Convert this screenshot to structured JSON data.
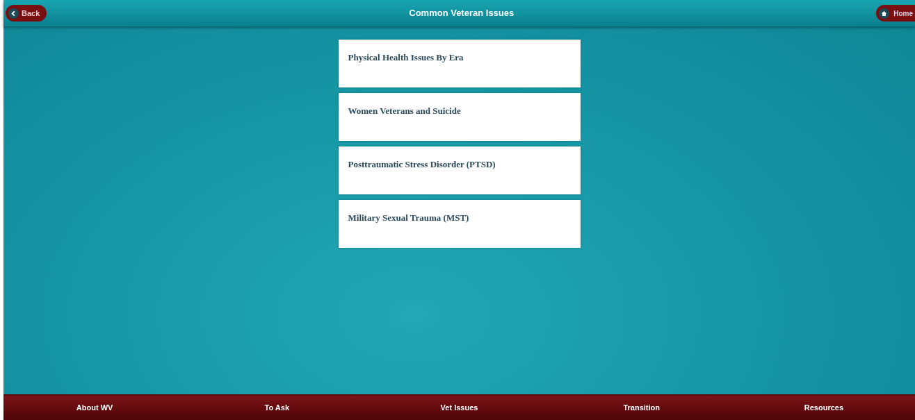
{
  "header": {
    "back_button": "Back",
    "title": "Common Veteran Issues",
    "home_button": "Home"
  },
  "topics": [
    {
      "title": "Physical Health Issues By Era"
    },
    {
      "title": "Women Veterans and Suicide"
    },
    {
      "title": "Posttraumatic Stress Disorder (PTSD)"
    },
    {
      "title": "Military Sexual Trauma (MST)"
    }
  ],
  "footer_nav": [
    {
      "label": "About WV"
    },
    {
      "label": "To Ask"
    },
    {
      "label": "Vet Issues"
    },
    {
      "label": "Transition"
    },
    {
      "label": "Resources"
    }
  ]
}
